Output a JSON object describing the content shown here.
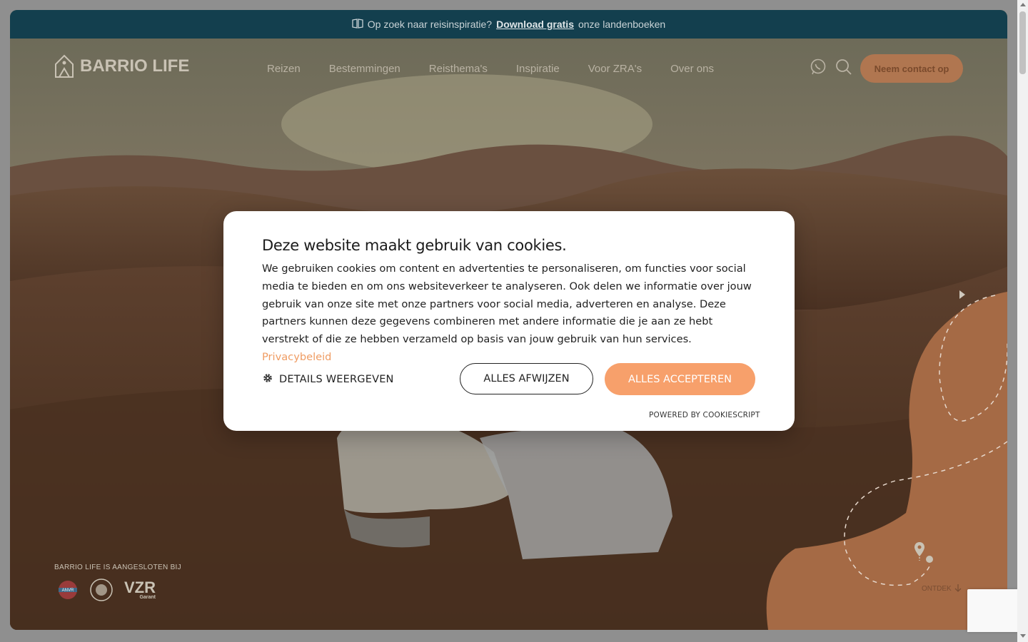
{
  "announcement": {
    "text_before": "Op zoek naar reisinspiratie?",
    "link": "Download gratis",
    "text_after": "onze landenboeken",
    "icon": "book-icon"
  },
  "header": {
    "logo_text": "BARRIO LIFE",
    "menu": [
      {
        "label": "Reizen"
      },
      {
        "label": "Bestemmingen"
      },
      {
        "label": "Reisthema's"
      },
      {
        "label": "Inspiratie"
      },
      {
        "label": "Voor ZRA's"
      },
      {
        "label": "Over ons"
      }
    ],
    "cta_label": "Neem contact op",
    "icons": [
      "whatsapp-icon",
      "search-icon"
    ]
  },
  "footer_hero": {
    "affiliation_label": "BARRIO LIFE IS AANGESLOTEN BIJ",
    "logos": [
      "ANVR",
      "Calamiteitenfonds",
      "VZR"
    ],
    "vzr_sub": "Garant",
    "anvr_text": "ANVR",
    "discover_label": "ONTDEK"
  },
  "cookie_modal": {
    "title": "Deze website maakt gebruik van cookies.",
    "body": "We gebruiken cookies om content en advertenties te personaliseren, om functies voor social media te bieden en om ons websiteverkeer te analyseren. Ook delen we informatie over jouw gebruik van onze site met onze partners voor social media, adverteren en analyse. Deze partners kunnen deze gegevens combineren met andere informatie die je aan ze hebt verstrekt of die ze hebben verzameld op basis van jouw gebruik van hun services.",
    "privacy_link": "Privacybeleid",
    "details_label": "DETAILS WEERGEVEN",
    "decline_label": "ALLES AFWIJZEN",
    "accept_label": "ALLES ACCEPTEREN",
    "powered_by": "POWERED BY COOKIESCRIPT"
  },
  "colors": {
    "topbar": "#133f4e",
    "accent": "#f7a06b",
    "cta_dimmed": "#b07650"
  }
}
